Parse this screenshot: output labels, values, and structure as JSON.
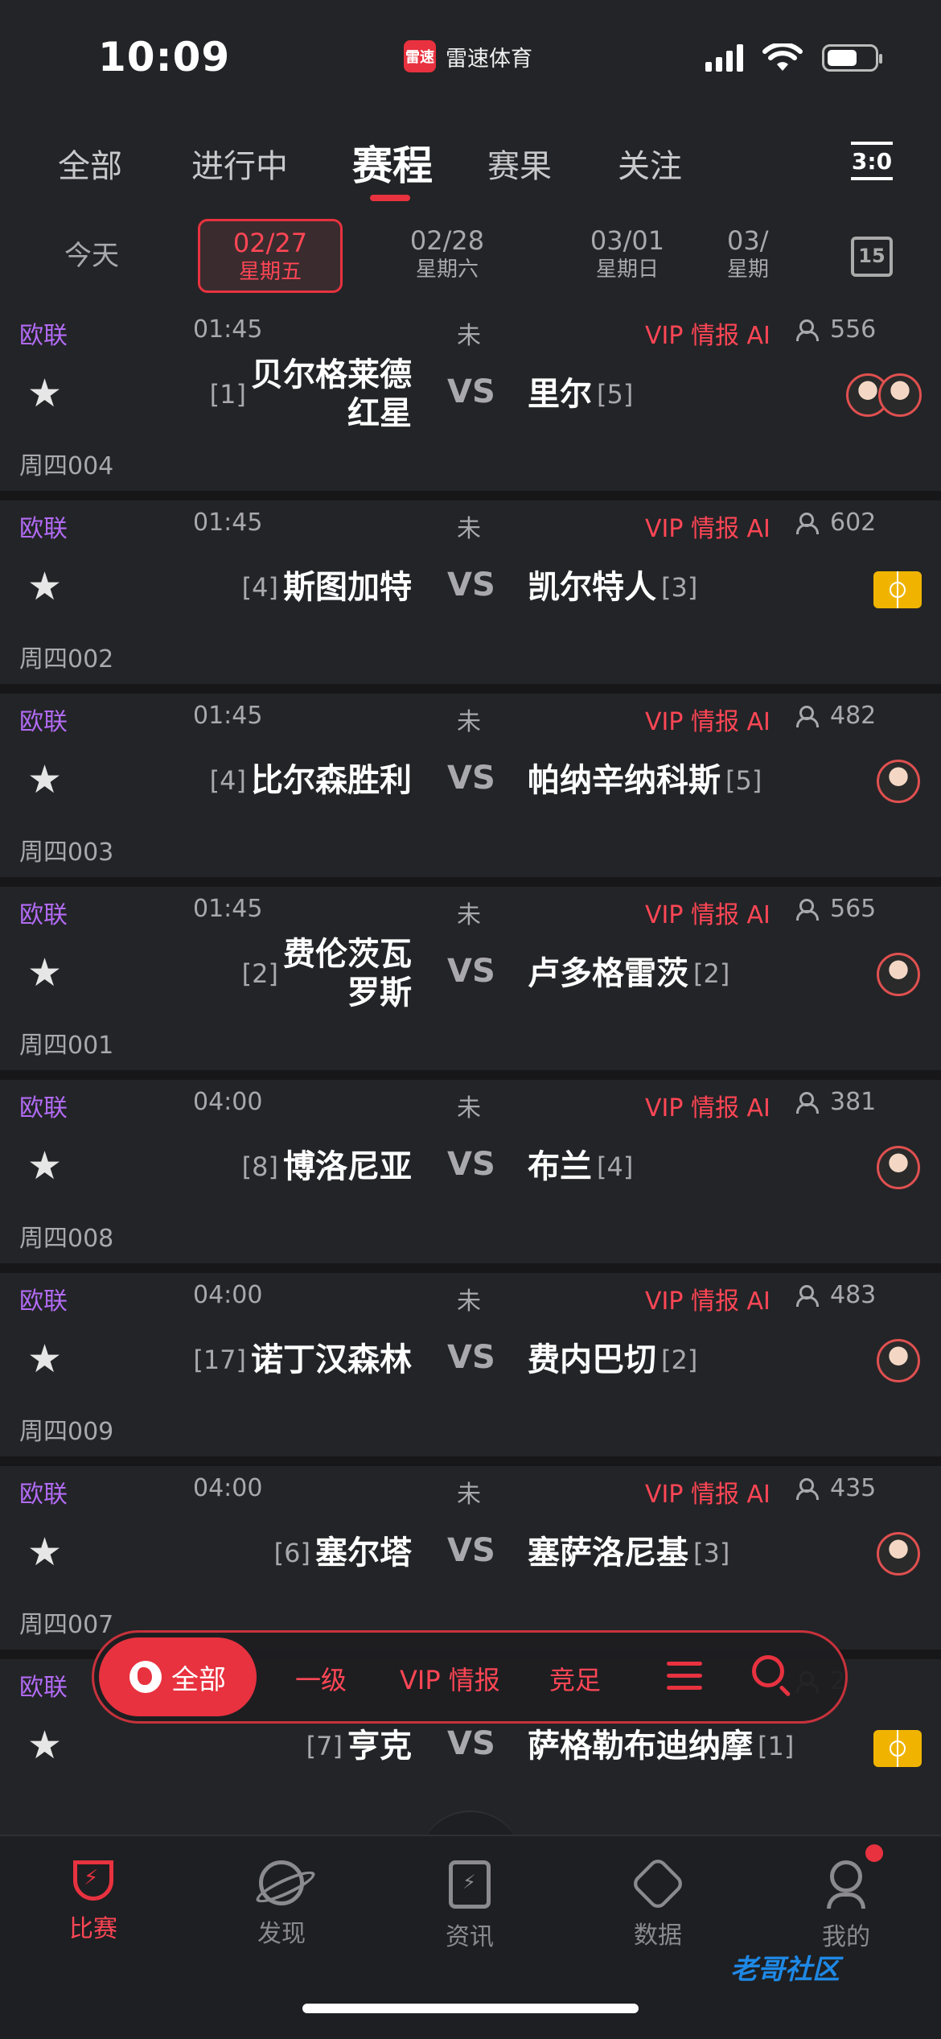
{
  "status": {
    "time": "10:09",
    "app_name": "雷速体育",
    "app_logo_text": "雷速"
  },
  "tabs": [
    {
      "label": "全部"
    },
    {
      "label": "进行中"
    },
    {
      "label": "赛程"
    },
    {
      "label": "赛果"
    },
    {
      "label": "关注"
    }
  ],
  "score_icon_text": "3:0",
  "dates": {
    "today": "今天",
    "items": [
      {
        "date": "02/27",
        "weekday": "星期五"
      },
      {
        "date": "02/28",
        "weekday": "星期六"
      },
      {
        "date": "03/01",
        "weekday": "星期日"
      },
      {
        "date": "03/",
        "weekday": "星期"
      }
    ],
    "calendar_day": "15"
  },
  "vip_label": "VIP 情报 AI",
  "vs_label": "VS",
  "matches": [
    {
      "league": "欧联",
      "time": "01:45",
      "status": "未",
      "watchers": "556",
      "home_rank": "[1]",
      "home": "贝尔格莱德\n红星",
      "away": "里尔",
      "away_rank": "[5]",
      "week_id": "周四004",
      "badge": "avatar2"
    },
    {
      "league": "欧联",
      "time": "01:45",
      "status": "未",
      "watchers": "602",
      "home_rank": "[4]",
      "home": "斯图加特",
      "away": "凯尔特人",
      "away_rank": "[3]",
      "week_id": "周四002",
      "badge": "pitch"
    },
    {
      "league": "欧联",
      "time": "01:45",
      "status": "未",
      "watchers": "482",
      "home_rank": "[4]",
      "home": "比尔森胜利",
      "away": "帕纳辛纳科斯",
      "away_rank": "[5]",
      "week_id": "周四003",
      "badge": "avatar"
    },
    {
      "league": "欧联",
      "time": "01:45",
      "status": "未",
      "watchers": "565",
      "home_rank": "[2]",
      "home": "费伦茨瓦\n罗斯",
      "away": "卢多格雷茨",
      "away_rank": "[2]",
      "week_id": "周四001",
      "badge": "avatar"
    },
    {
      "league": "欧联",
      "time": "04:00",
      "status": "未",
      "watchers": "381",
      "home_rank": "[8]",
      "home": "博洛尼亚",
      "away": "布兰",
      "away_rank": "[4]",
      "week_id": "周四008",
      "badge": "avatar"
    },
    {
      "league": "欧联",
      "time": "04:00",
      "status": "未",
      "watchers": "483",
      "home_rank": "[17]",
      "home": "诺丁汉森林",
      "away": "费内巴切",
      "away_rank": "[2]",
      "week_id": "周四009",
      "badge": "avatar"
    },
    {
      "league": "欧联",
      "time": "04:00",
      "status": "未",
      "watchers": "435",
      "home_rank": "[6]",
      "home": "塞尔塔",
      "away": "塞萨洛尼基",
      "away_rank": "[3]",
      "week_id": "周四007",
      "badge": "avatar"
    },
    {
      "league": "欧联",
      "time": "",
      "status": "",
      "watchers": "2",
      "home_rank": "[7]",
      "home": "亨克",
      "away": "萨格勒布迪纳摩",
      "away_rank": "[1]",
      "week_id": "",
      "badge": "pitch"
    }
  ],
  "filterbar": {
    "all": "全部",
    "level1": "一级",
    "vip": "VIP 情报",
    "jingzu": "竞足"
  },
  "bottom_nav": [
    {
      "label": "比赛",
      "icon": "trophy-icon"
    },
    {
      "label": "发现",
      "icon": "planet-icon"
    },
    {
      "label": "资讯",
      "icon": "news-icon"
    },
    {
      "label": "数据",
      "icon": "data-icon"
    },
    {
      "label": "我的",
      "icon": "profile-icon"
    }
  ],
  "watermark": "老哥社区",
  "colors": {
    "accent": "#e8323f",
    "league": "#b26bf5",
    "background": "#232427"
  }
}
